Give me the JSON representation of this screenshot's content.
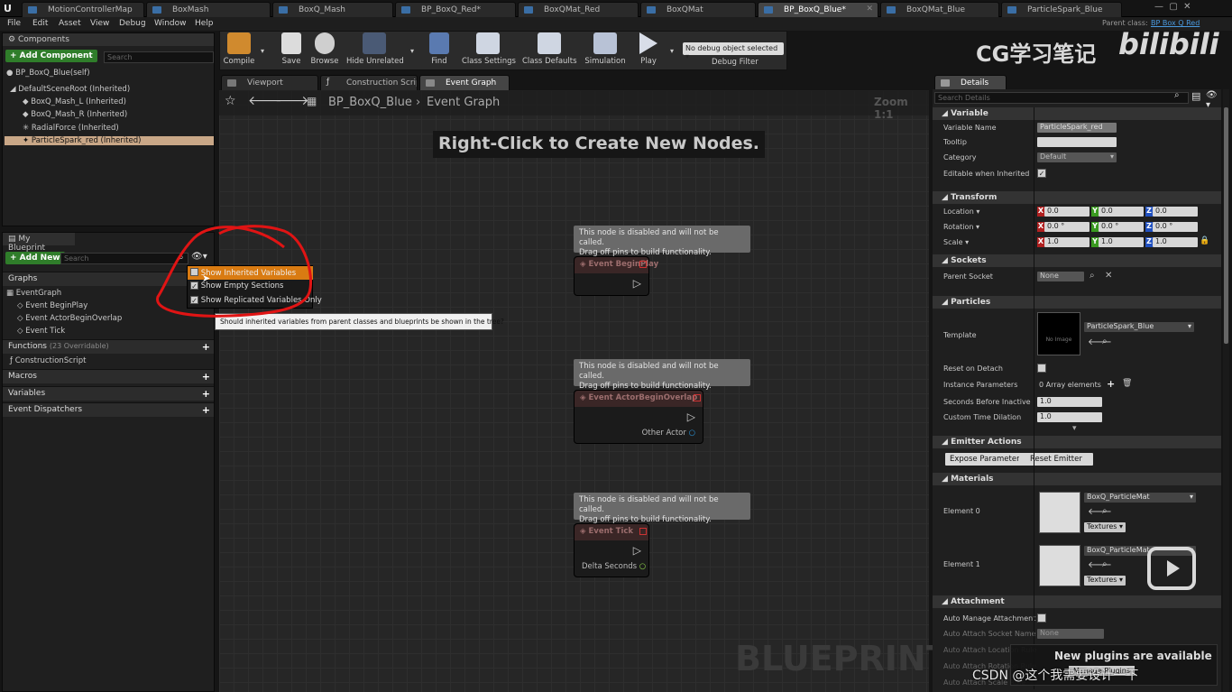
{
  "tabs": [
    "MotionControllerMap",
    "BoxMash",
    "BoxQ_Mash",
    "BP_BoxQ_Red*",
    "BoxQMat_Red",
    "BoxQMat",
    "BP_BoxQ_Blue*",
    "BoxQMat_Blue",
    "ParticleSpark_Blue"
  ],
  "parent_class": {
    "label": "Parent class:",
    "value": "BP Box Q Red"
  },
  "menu": [
    "File",
    "Edit",
    "Asset",
    "View",
    "Debug",
    "Window",
    "Help"
  ],
  "toolbar": {
    "compile": "Compile",
    "save": "Save",
    "browse": "Browse",
    "hide": "Hide Unrelated",
    "find": "Find",
    "class_settings": "Class Settings",
    "class_defaults": "Class Defaults",
    "simulation": "Simulation",
    "play": "Play",
    "debug_select": "No debug object selected",
    "debug_filter": "Debug Filter"
  },
  "watermark": {
    "text": "CG学习笔记",
    "brand": "bilibili"
  },
  "components": {
    "title": "Components",
    "add": "+ Add Component",
    "search_placeholder": "Search",
    "self": "BP_BoxQ_Blue(self)",
    "items": [
      "DefaultSceneRoot (Inherited)",
      "BoxQ_Mash_L (Inherited)",
      "BoxQ_Mash_R (Inherited)",
      "RadialForce (Inherited)",
      "ParticleSpark_red (Inherited)"
    ]
  },
  "myblueprint": {
    "title": "My Blueprint",
    "add": "+ Add New",
    "search_placeholder": "Search",
    "graphs": "Graphs",
    "eventgraph": "EventGraph",
    "events": [
      "Event BeginPlay",
      "Event ActorBeginOverlap",
      "Event Tick"
    ],
    "functions": "Functions",
    "functions_count": "(23 Overridable)",
    "construction": "ConstructionScript",
    "macros": "Macros",
    "variables": "Variables",
    "dispatchers": "Event Dispatchers"
  },
  "dropdown": {
    "items": [
      "Show Inherited Variables",
      "Show Empty Sections",
      "Show Replicated Variables Only"
    ],
    "checked": [
      false,
      true,
      true
    ],
    "tooltip": "Should inherited variables from parent classes and blueprints be shown in the tree?"
  },
  "graphtabs": [
    "Viewport",
    "Construction Scrip",
    "Event Graph"
  ],
  "breadcrumb": {
    "bp": "BP_BoxQ_Blue",
    "graph": "Event Graph",
    "zoom": "Zoom 1:1"
  },
  "graph_hint": "Right-Click to Create New Nodes.",
  "disabled_note": [
    "This node is disabled and will not be called.",
    "Drag off pins to build functionality."
  ],
  "nodes": [
    {
      "title": "Event BeginPlay",
      "pin": ""
    },
    {
      "title": "Event ActorBeginOverlap",
      "pin": "Other Actor"
    },
    {
      "title": "Event Tick",
      "pin": "Delta Seconds"
    }
  ],
  "blueprint_label": "BLUEPRINT",
  "details": {
    "title": "Details",
    "search_placeholder": "Search Details",
    "variable": {
      "section": "Variable",
      "name_label": "Variable Name",
      "name": "ParticleSpark_red",
      "tooltip_label": "Tooltip",
      "category_label": "Category",
      "category": "Default",
      "editable_label": "Editable when Inherited"
    },
    "transform": {
      "section": "Transform",
      "location": "Location",
      "rotation": "Rotation",
      "scale": "Scale",
      "loc": [
        "0.0",
        "0.0",
        "0.0"
      ],
      "rot": [
        "0.0 °",
        "0.0 °",
        "0.0 °"
      ],
      "scl": [
        "1.0",
        "1.0",
        "1.0"
      ]
    },
    "sockets": {
      "section": "Sockets",
      "parent_label": "Parent Socket",
      "parent": "None"
    },
    "particles": {
      "section": "Particles",
      "template_label": "Template",
      "template": "ParticleSpark_Blue",
      "thumb": "No Image",
      "reset_label": "Reset on Detach",
      "instance_label": "Instance Parameters",
      "instance": "0 Array elements",
      "seconds_label": "Seconds Before Inactive",
      "seconds": "1.0",
      "dilation_label": "Custom Time Dilation",
      "dilation": "1.0"
    },
    "emitter": {
      "section": "Emitter Actions",
      "expose": "Expose Parameter",
      "reset": "Reset Emitter"
    },
    "materials": {
      "section": "Materials",
      "el0_label": "Element 0",
      "el1_label": "Element 1",
      "mat": "BoxQ_ParticleMat",
      "textures": "Textures ▾"
    },
    "attachment": {
      "section": "Attachment",
      "auto_manage": "Auto Manage Attachment",
      "socket_name": "Auto Attach Socket Name",
      "socket_val": "None",
      "location": "Auto Attach Location Rule",
      "rotation": "Auto Attach Rotation Rule",
      "scale": "Auto Attach Scale Rule"
    }
  },
  "notification": "New plugins are available",
  "notification_sub": "Manage Plugins",
  "csdn": "CSDN @这个我需要设计一下"
}
